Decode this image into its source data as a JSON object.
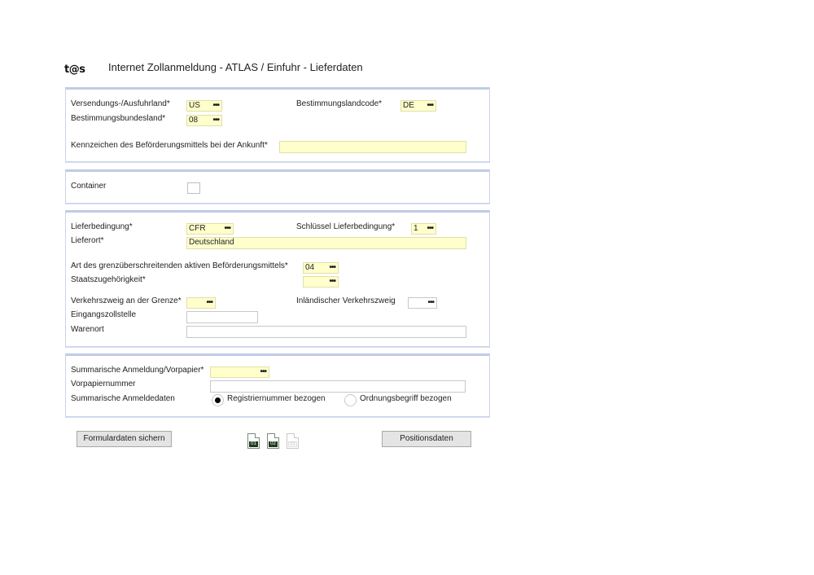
{
  "header": {
    "logo": "t@s",
    "title": "Internet Zollanmeldung  -  ATLAS / Einfuhr  -  Lieferdaten"
  },
  "section1": {
    "versendungsland_label": "Versendungs-/Ausfuhrland*",
    "versendungsland_value": "US",
    "bestimmungslandcode_label": "Bestimmungslandcode*",
    "bestimmungslandcode_value": "DE",
    "bestimmungsbundesland_label": "Bestimmungsbundesland*",
    "bestimmungsbundesland_value": "08",
    "kennzeichen_label": "Kennzeichen des Beförderungsmittels bei der Ankunft*",
    "kennzeichen_value": ""
  },
  "section2": {
    "container_label": "Container",
    "container_checked": false
  },
  "section3": {
    "lieferbedingung_label": "Lieferbedingung*",
    "lieferbedingung_value": "CFR",
    "schluessel_label": "Schlüssel Lieferbedingung*",
    "schluessel_value": "1",
    "lieferort_label": "Lieferort*",
    "lieferort_value": "Deutschland",
    "art_label": "Art des grenzüberschreitenden aktiven Beförderungsmittels*",
    "art_value": "04",
    "staatszugehoerigkeit_label": "Staatszugehörigkeit*",
    "staatszugehoerigkeit_value": "",
    "verkehrszweig_grenze_label": "Verkehrszweig an der Grenze*",
    "verkehrszweig_grenze_value": "",
    "inlaendischer_label": "Inländischer Verkehrszweig",
    "inlaendischer_value": "",
    "eingangszollstelle_label": "Eingangszollstelle",
    "eingangszollstelle_value": "",
    "warenort_label": "Warenort",
    "warenort_value": ""
  },
  "section4": {
    "summarische_label": "Summarische Anmeldung/Vorpapier*",
    "summarische_value": "",
    "vorpapiernummer_label": "Vorpapiernummer",
    "vorpapiernummer_value": "",
    "anmeldedaten_label": "Summarische Anmeldedaten",
    "radio1_label": "Registriernummer bezogen",
    "radio2_label": "Ordnungsbegriff bezogen",
    "selected": "Registriernummer bezogen"
  },
  "footer": {
    "save_button": "Formulardaten sichern",
    "positions_button": "Positionsdaten",
    "pages": [
      {
        "label": "01",
        "active": true
      },
      {
        "label": "02",
        "active": true
      },
      {
        "label": "03",
        "active": false
      }
    ]
  },
  "dots_glyph": "•••"
}
